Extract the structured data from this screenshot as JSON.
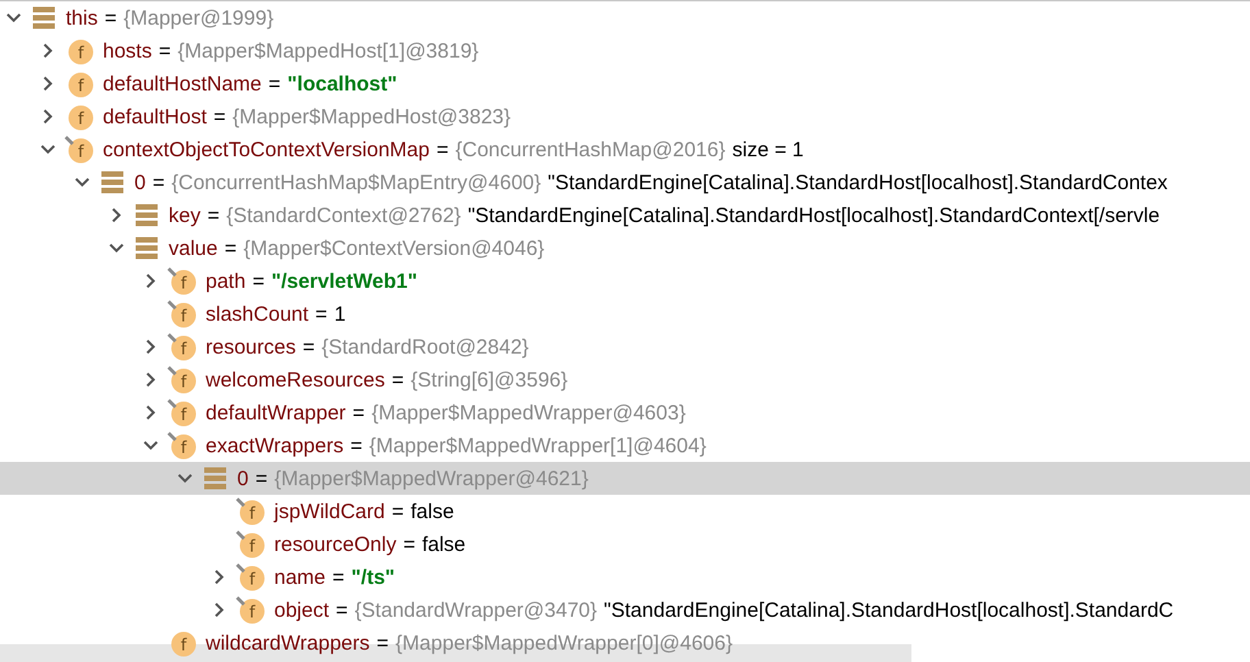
{
  "variables": [
    {
      "kind": "object",
      "name": "this",
      "sep": "=",
      "type": "{Mapper@1999}",
      "expanded": true,
      "selected": false,
      "children": [
        {
          "kind": "field",
          "badge": "f",
          "marked": false,
          "name": "hosts",
          "sep": "=",
          "type": "{Mapper$MappedHost[1]@3819}",
          "expanded": false,
          "selected": false
        },
        {
          "kind": "field",
          "badge": "f",
          "marked": false,
          "name": "defaultHostName",
          "sep": "=",
          "string": "\"localhost\"",
          "expanded": false,
          "selected": false
        },
        {
          "kind": "field",
          "badge": "f",
          "marked": false,
          "name": "defaultHost",
          "sep": "=",
          "type": "{Mapper$MappedHost@3823}",
          "expanded": false,
          "selected": false
        },
        {
          "kind": "field",
          "badge": "f",
          "marked": true,
          "name": "contextObjectToContextVersionMap",
          "sep": "=",
          "type": "{ConcurrentHashMap@2016}",
          "value": "size = 1",
          "expanded": true,
          "selected": false,
          "children": [
            {
              "kind": "object",
              "name": "0",
              "sep": "=",
              "type": "{ConcurrentHashMap$MapEntry@4600}",
              "value": "\"StandardEngine[Catalina].StandardHost[localhost].StandardContex",
              "expanded": true,
              "selected": false,
              "children": [
                {
                  "kind": "object",
                  "name": "key",
                  "sep": "=",
                  "type": "{StandardContext@2762}",
                  "value": "\"StandardEngine[Catalina].StandardHost[localhost].StandardContext[/servle",
                  "expanded": false,
                  "selected": false
                },
                {
                  "kind": "object",
                  "name": "value",
                  "sep": "=",
                  "type": "{Mapper$ContextVersion@4046}",
                  "expanded": true,
                  "selected": false,
                  "children": [
                    {
                      "kind": "field",
                      "badge": "f",
                      "marked": true,
                      "name": "path",
                      "sep": "=",
                      "string": "\"/servletWeb1\"",
                      "expanded": false,
                      "selected": false
                    },
                    {
                      "kind": "field",
                      "badge": "f",
                      "marked": true,
                      "name": "slashCount",
                      "sep": "=",
                      "value": "1",
                      "selected": false
                    },
                    {
                      "kind": "field",
                      "badge": "f",
                      "marked": true,
                      "name": "resources",
                      "sep": "=",
                      "type": "{StandardRoot@2842}",
                      "expanded": false,
                      "selected": false
                    },
                    {
                      "kind": "field",
                      "badge": "f",
                      "marked": true,
                      "name": "welcomeResources",
                      "sep": "=",
                      "type": "{String[6]@3596}",
                      "expanded": false,
                      "selected": false
                    },
                    {
                      "kind": "field",
                      "badge": "f",
                      "marked": true,
                      "name": "defaultWrapper",
                      "sep": "=",
                      "type": "{Mapper$MappedWrapper@4603}",
                      "expanded": false,
                      "selected": false
                    },
                    {
                      "kind": "field",
                      "badge": "f",
                      "marked": true,
                      "name": "exactWrappers",
                      "sep": "=",
                      "type": "{Mapper$MappedWrapper[1]@4604}",
                      "expanded": true,
                      "selected": false,
                      "children": [
                        {
                          "kind": "object",
                          "name": "0",
                          "sep": "=",
                          "type": "{Mapper$MappedWrapper@4621}",
                          "expanded": true,
                          "selected": true,
                          "children": [
                            {
                              "kind": "field",
                              "badge": "f",
                              "marked": true,
                              "name": "jspWildCard",
                              "sep": "=",
                              "value": "false",
                              "selected": false
                            },
                            {
                              "kind": "field",
                              "badge": "f",
                              "marked": true,
                              "name": "resourceOnly",
                              "sep": "=",
                              "value": "false",
                              "selected": false
                            },
                            {
                              "kind": "field",
                              "badge": "f",
                              "marked": true,
                              "name": "name",
                              "sep": "=",
                              "string": "\"/ts\"",
                              "expanded": false,
                              "selected": false
                            },
                            {
                              "kind": "field",
                              "badge": "f",
                              "marked": true,
                              "name": "object",
                              "sep": "=",
                              "type": "{StandardWrapper@3470}",
                              "value": "\"StandardEngine[Catalina].StandardHost[localhost].StandardC",
                              "expanded": false,
                              "selected": false
                            }
                          ]
                        }
                      ]
                    },
                    {
                      "kind": "field",
                      "badge": "f",
                      "marked": false,
                      "name": "wildcardWrappers",
                      "sep": "=",
                      "type": "{Mapper$MappedWrapper[0]@4606}",
                      "selected": false
                    }
                  ]
                }
              ]
            }
          ]
        }
      ]
    }
  ]
}
